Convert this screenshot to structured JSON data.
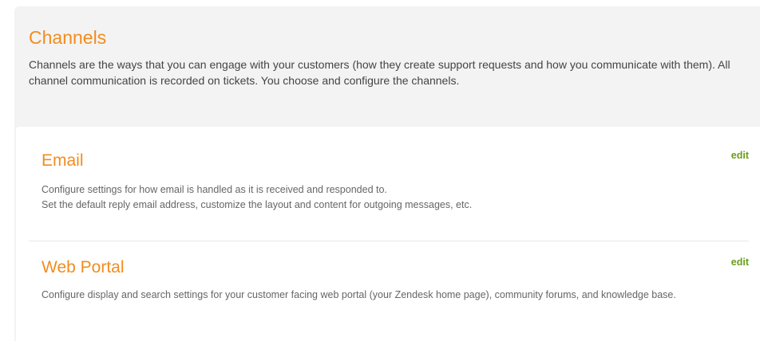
{
  "channels": {
    "title": "Channels",
    "description": "Channels are the ways that you can engage with your customers (how they create support requests and how you communicate with them). All channel communication is recorded on tickets. You choose and configure the channels.",
    "sections": [
      {
        "title": "Email",
        "edit_label": "edit",
        "description_lines": [
          "Configure settings for how email is handled as it is received and responded to.",
          "Set the default reply email address, customize the layout and content for outgoing messages, etc."
        ]
      },
      {
        "title": "Web Portal",
        "edit_label": "edit",
        "description_lines": [
          "Configure display and search settings for your customer facing web portal (your Zendesk home page), community forums, and knowledge base."
        ]
      }
    ]
  },
  "colors": {
    "accent_orange": "#f28c1e",
    "edit_green": "#6a9e1a",
    "panel_bg": "#f3f3f3"
  }
}
